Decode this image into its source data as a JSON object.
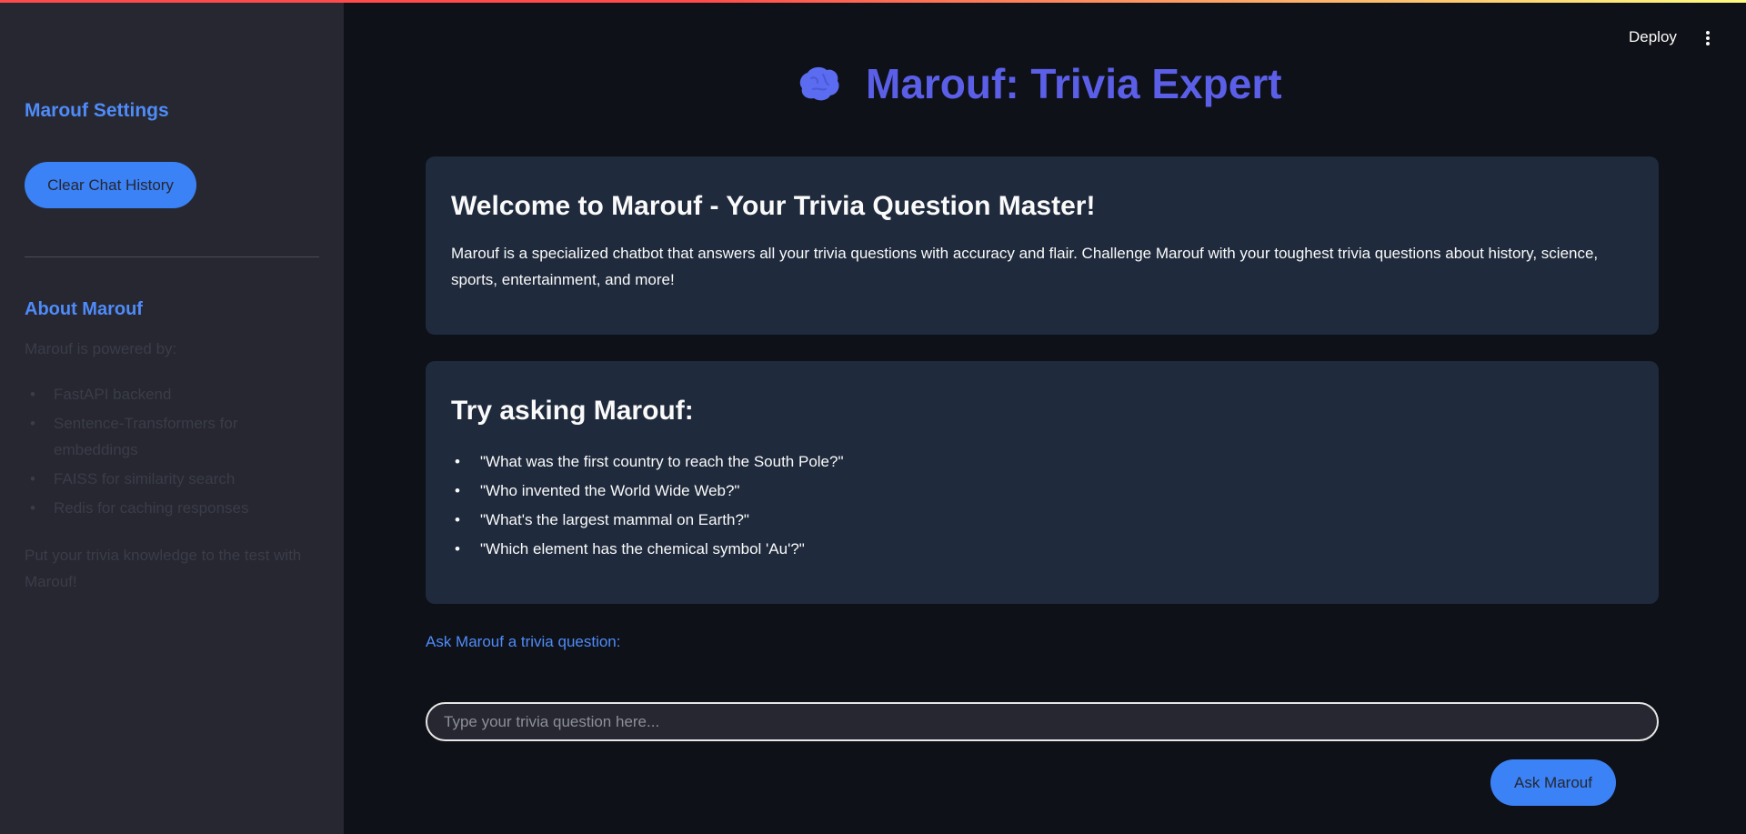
{
  "header": {
    "deploy_label": "Deploy",
    "menu_icon": "kebab-menu-icon"
  },
  "sidebar": {
    "title": "Marouf Settings",
    "clear_button": "Clear Chat History",
    "about_title": "About Marouf",
    "about_intro": "Marouf is powered by:",
    "about_items": [
      {
        "label": "FastAPI backend"
      },
      {
        "label": "Sentence-Transformers for embeddings"
      },
      {
        "label": "FAISS for similarity search"
      },
      {
        "label": "Redis for caching responses"
      }
    ],
    "about_outro": "Put your trivia knowledge to the test with Marouf!"
  },
  "main": {
    "title_icon": "brain-icon",
    "title": "Marouf: Trivia Expert",
    "welcome": {
      "heading": "Welcome to Marouf - Your Trivia Question Master!",
      "body": "Marouf is a specialized chatbot that answers all your trivia questions with accuracy and flair. Challenge Marouf with your toughest trivia questions about history, science, sports, entertainment, and more!"
    },
    "examples": {
      "heading": "Try asking Marouf:",
      "items": [
        {
          "text": "\"What was the first country to reach the South Pole?\""
        },
        {
          "text": "\"Who invented the World Wide Web?\""
        },
        {
          "text": "\"What's the largest mammal on Earth?\""
        },
        {
          "text": "\"Which element has the chemical symbol 'Au'?\""
        }
      ]
    },
    "ask_label": "Ask Marouf a trivia question:",
    "input": {
      "value": "",
      "placeholder": "Type your trivia question here..."
    },
    "ask_button": "Ask Marouf"
  },
  "colors": {
    "accent_blue": "#4f8bf9",
    "button_blue": "#3b82f6",
    "title_purple": "#5b5fe8",
    "background": "#0e1117",
    "sidebar_bg": "#262730",
    "card_bg": "#1f2a3c"
  }
}
